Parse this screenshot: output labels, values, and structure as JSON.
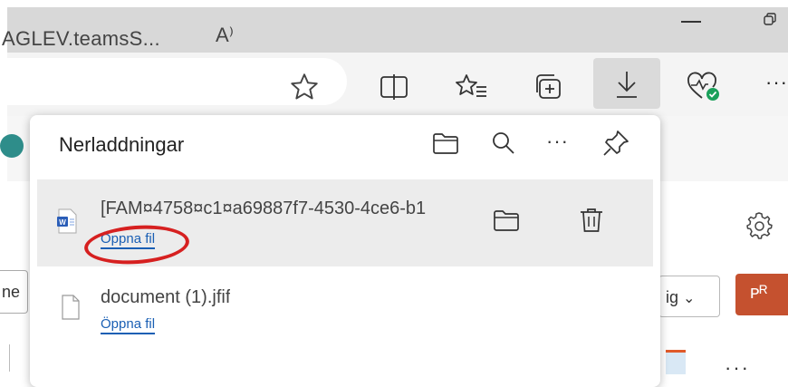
{
  "toolbar": {
    "address_text": "AGLEV.teamsS...",
    "read_aloud_glyph": "A⁾"
  },
  "page": {
    "left_sliver_text": "ne",
    "dropdown_text": "ig",
    "people_text": "ᴩᴿ"
  },
  "downloads": {
    "title": "Nerladdningar",
    "items": [
      {
        "filename": "[FAM¤4758¤c1¤a69887f7-4530-4ce6-b1",
        "open_label": "Öppna fil",
        "file_type_icon": "word-file-icon"
      },
      {
        "filename": "document (1).jfif",
        "open_label": "Öppna fil",
        "file_type_icon": "generic-file-icon"
      }
    ]
  },
  "colors": {
    "link": "#1a5fb4",
    "highlight_ring": "#d62020",
    "people_button": "#c5512f",
    "health_badge": "#1aa05a",
    "teal": "#2e8d8a"
  }
}
